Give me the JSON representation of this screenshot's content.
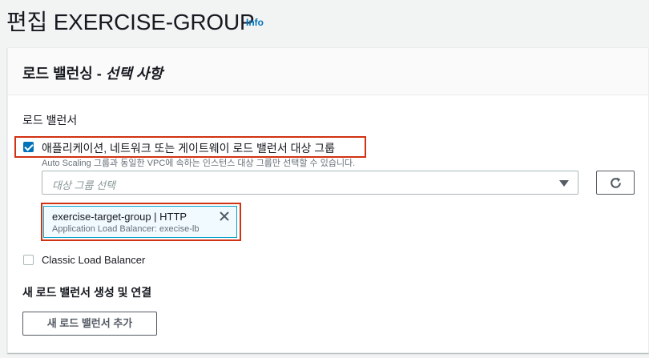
{
  "header": {
    "title": "편집 EXERCISE-GROUP",
    "info_link": "Info"
  },
  "panel": {
    "title": "로드 밸런싱 - ",
    "title_optional": "선택 사항",
    "section_label": "로드 밸런서",
    "alb_option": {
      "label": "애플리케이션, 네트워크 또는 게이트웨이 로드 밸런서 대상 그룹",
      "checked": true,
      "description": "Auto Scaling 그룹과 동일한 VPC에 속하는 인스턴스 대상 그룹만 선택할 수 있습니다."
    },
    "target_group_select": {
      "placeholder": "대상 그룹 선택"
    },
    "selected_token": {
      "title": "exercise-target-group | HTTP",
      "subtitle": "Application Load Balancer: execise-lb"
    },
    "classic_option": {
      "label": "Classic Load Balancer",
      "checked": false
    },
    "new_lb_heading": "새 로드 밸런서 생성 및 연결",
    "add_lb_button": "새 로드 밸런서 추가"
  },
  "colors": {
    "accent": "#0073bb",
    "highlight_border": "#d13212",
    "token_bg": "#f1faff",
    "token_border": "#00a1c9"
  },
  "icons": {
    "refresh": "refresh-icon",
    "dropdown": "caret-down-icon",
    "remove": "close-icon"
  }
}
